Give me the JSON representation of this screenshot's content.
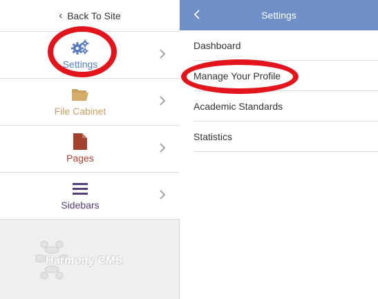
{
  "back_link": {
    "label": "Back To Site"
  },
  "nav": {
    "items": [
      {
        "label": "Settings",
        "icon": "gears-icon",
        "color": "#5a7bbf"
      },
      {
        "label": "File Cabinet",
        "icon": "folder-icon",
        "color": "#c8a060"
      },
      {
        "label": "Pages",
        "icon": "page-icon",
        "color": "#a5402e"
      },
      {
        "label": "Sidebars",
        "icon": "bars-icon",
        "color": "#553c7d"
      }
    ]
  },
  "logo": {
    "text": "Harmony CMS"
  },
  "panel": {
    "title": "Settings",
    "header_color": "#6f8fc7",
    "items": [
      {
        "label": "Dashboard"
      },
      {
        "label": "Manage Your Profile"
      },
      {
        "label": "Academic Standards"
      },
      {
        "label": "Statistics"
      }
    ]
  },
  "annotation_color": "#e3141c"
}
